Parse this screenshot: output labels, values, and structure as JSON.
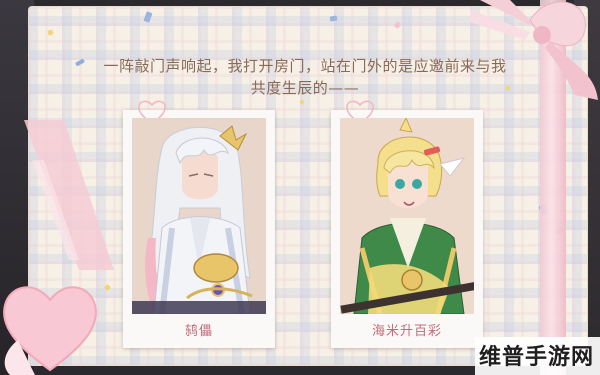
{
  "story": {
    "line1": "一阵敲门声响起，我打开房门，站在门外的是应邀前来与我",
    "line2": "共度生辰的——"
  },
  "cards": [
    {
      "name": "鸫儡"
    },
    {
      "name": "海米升百彩"
    }
  ],
  "watermark": {
    "text": "维普手游网"
  },
  "colors": {
    "background": "#f6f0e6",
    "ribbon": "#f3c9d3",
    "text": "#8a6a57",
    "name": "#c06c7c"
  }
}
